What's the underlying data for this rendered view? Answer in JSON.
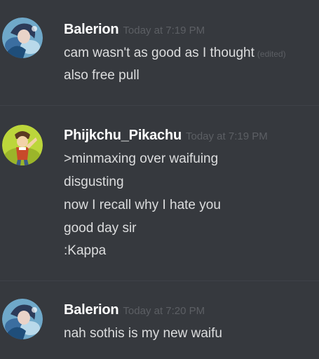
{
  "messages": [
    {
      "author": "Balerion",
      "timestamp": "Today at 7:19 PM",
      "lines": [
        {
          "text": "cam wasn't as good as I thought",
          "edited": "(edited)"
        },
        {
          "text": "also free pull"
        }
      ]
    },
    {
      "author": "Phijkchu_Pikachu",
      "timestamp": "Today at 7:19 PM",
      "lines": [
        {
          "text": ">minmaxing over waifuing"
        },
        {
          "text": "disgusting"
        },
        {
          "text": "now I recall why I hate you"
        },
        {
          "text": "good day sir"
        },
        {
          "text": ":Kappa"
        }
      ]
    },
    {
      "author": "Balerion",
      "timestamp": "Today at 7:20 PM",
      "lines": [
        {
          "text": "nah sothis is my new waifu"
        }
      ]
    }
  ],
  "colors": {
    "background": "#36393e",
    "username": "#ffffff",
    "timestamp": "#5c5f64",
    "message_text": "#dcddde",
    "divider": "#3f4248"
  },
  "icons": {
    "avatar_1": "anime-character-avatar",
    "avatar_2": "pikachu-avatar",
    "avatar_3": "anime-character-avatar"
  }
}
